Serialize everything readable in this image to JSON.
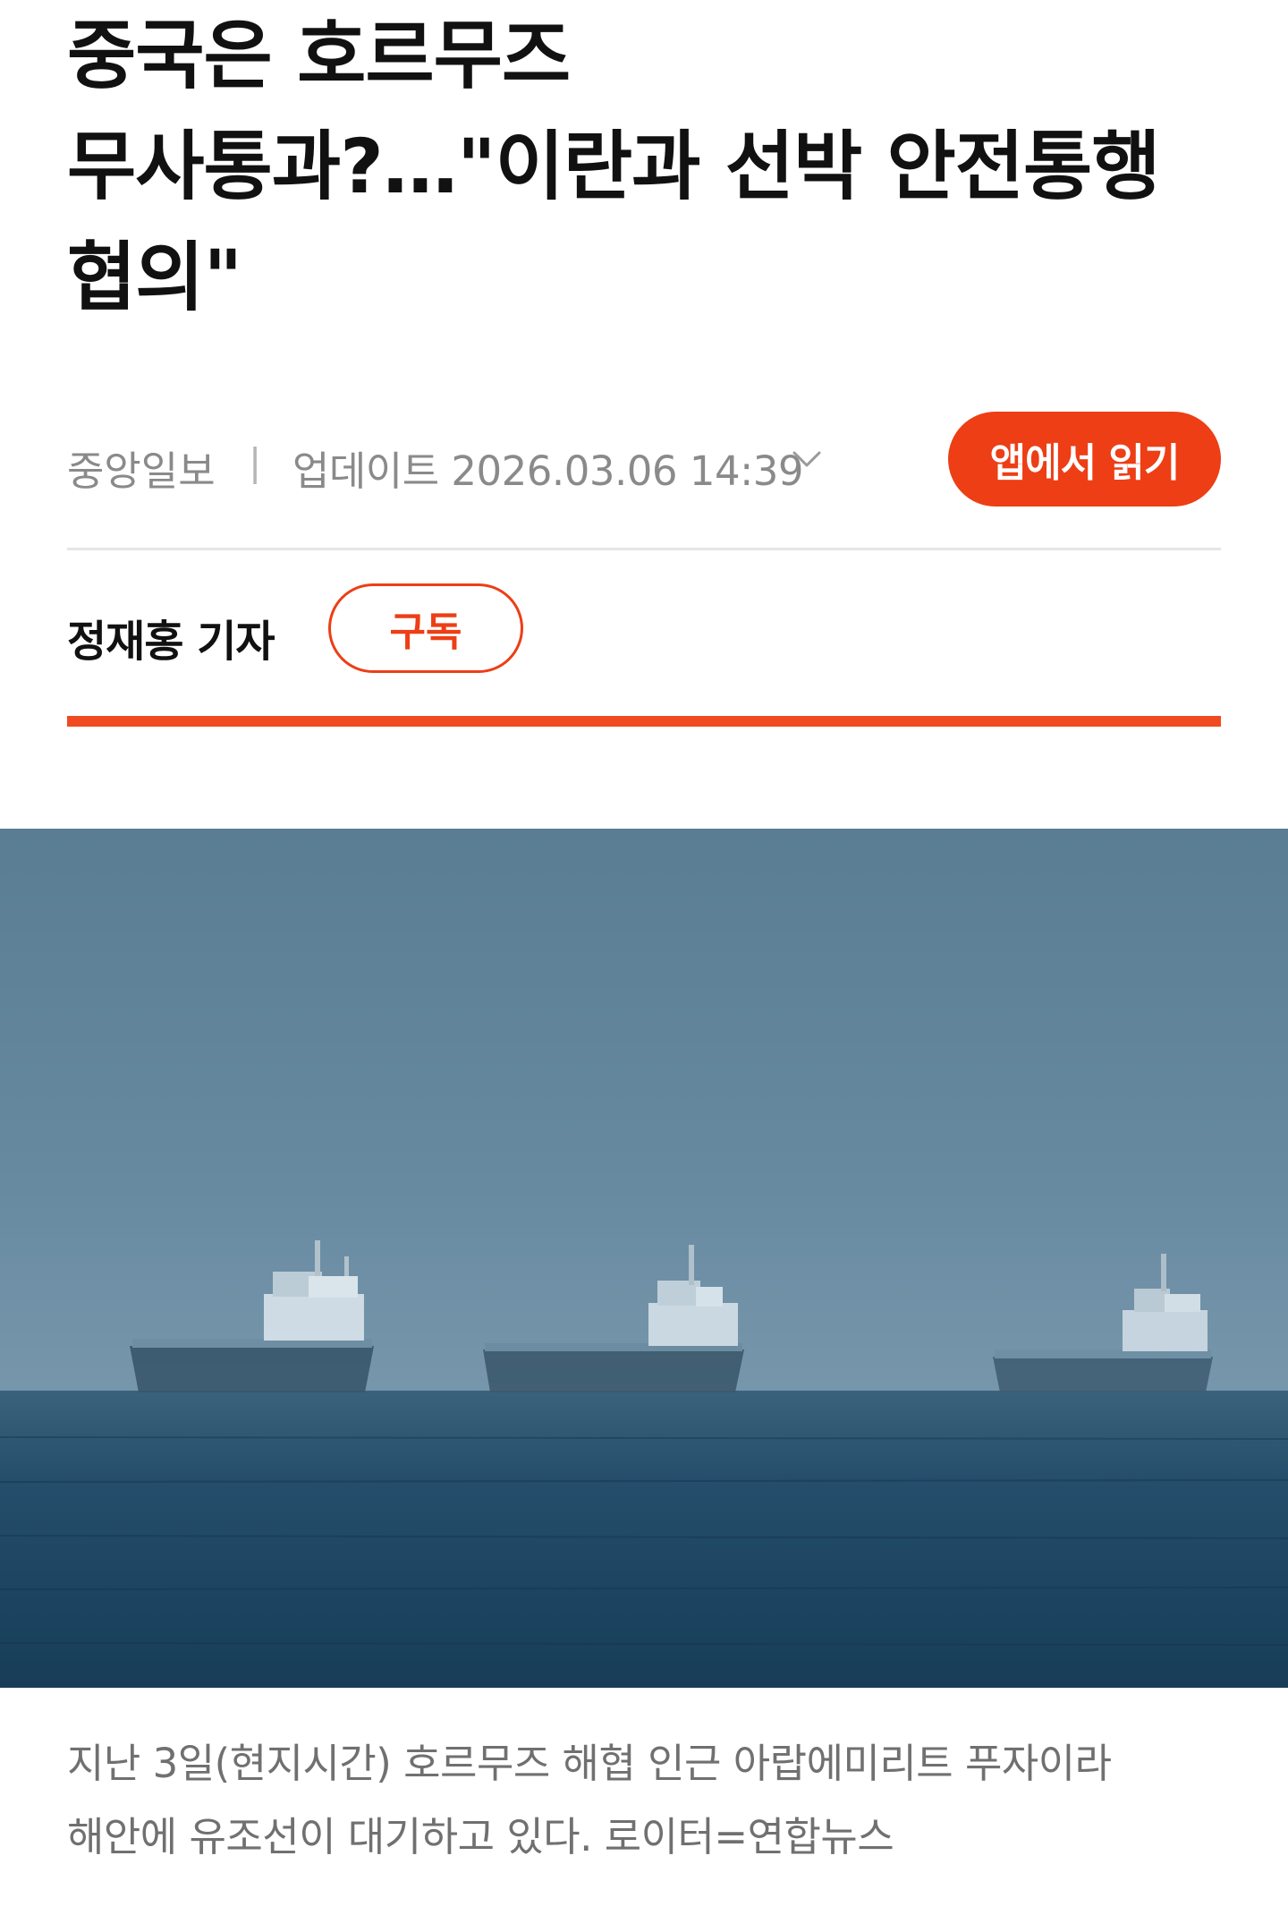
{
  "article": {
    "headline_lines": [
      "중국은 호르무즈",
      "무사통과?…\"이란과 선박 안전통행",
      "협의\""
    ],
    "source": "중앙일보",
    "separator": "|",
    "updated_label": "업데이트 2026.03.06 14:39",
    "reporter": "정재홍 기자"
  },
  "buttons": {
    "read_in_app": "앱에서 읽기",
    "subscribe": "구독"
  },
  "photo": {
    "caption_lines": [
      "지난 3일(현지시간) 호르무즈 해협 인근 아랍에미리트 푸자이라",
      "해안에 유조선이 대기하고 있다. 로이터=연합뉴스"
    ]
  },
  "colors": {
    "accent": "#ed3e15",
    "divider_accent": "#f04a23",
    "meta_text": "#8a8a8a",
    "caption_text": "#707070",
    "sky": "#5f8297",
    "sea": "#1f4a66"
  },
  "icons": {
    "expand": "chevron-down-icon"
  }
}
